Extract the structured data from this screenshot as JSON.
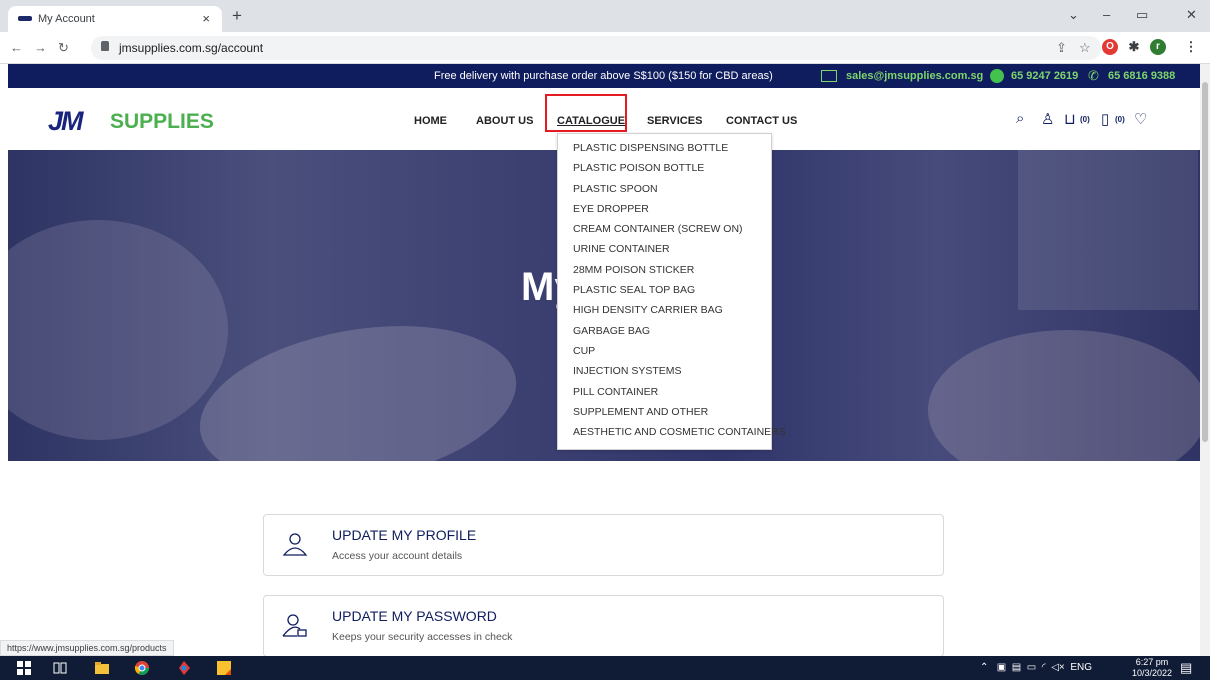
{
  "browser": {
    "tab_title": "My Account",
    "tab_close": "×",
    "new_tab": "+",
    "url": "jmsupplies.com.sg/account",
    "status_url": "https://www.jmsupplies.com.sg/products"
  },
  "topbar": {
    "promo": "Free delivery with purchase order above S$100 ($150 for CBD areas)",
    "email": "sales@jmsupplies.com.sg",
    "whatsapp": "65 9247 2619",
    "phone": "65 6816 9388"
  },
  "logo": {
    "jm": "JM",
    "supplies": "SUPPLIES"
  },
  "nav": {
    "home": "HOME",
    "about": "ABOUT US",
    "catalogue": "CATALOGUE",
    "services": "SERVICES",
    "contact": "CONTACT US"
  },
  "header_counts": {
    "cart": "(0)",
    "quote": "(0)"
  },
  "catalogue_menu": [
    "PLASTIC DISPENSING BOTTLE",
    "PLASTIC POISON BOTTLE",
    "PLASTIC SPOON",
    "EYE DROPPER",
    "CREAM CONTAINER (SCREW ON)",
    "URINE CONTAINER",
    "28MM POISON STICKER",
    "PLASTIC SEAL TOP BAG",
    "HIGH DENSITY CARRIER BAG",
    "GARBAGE BAG",
    "CUP",
    "INJECTION SYSTEMS",
    "PILL CONTAINER",
    "SUPPLEMENT AND OTHER",
    "AESTHETIC AND COSMETIC CONTAINERS"
  ],
  "hero": {
    "title_visible": "My"
  },
  "cards": [
    {
      "title": "UPDATE MY PROFILE",
      "subtitle": "Access your account details"
    },
    {
      "title": "UPDATE MY PASSWORD",
      "subtitle": "Keeps your security accesses in check"
    }
  ],
  "taskbar": {
    "lang": "ENG",
    "time": "6:27 pm",
    "date": "10/3/2022"
  },
  "colors": {
    "brand_navy": "#0f1d5e",
    "brand_green": "#4caf50",
    "highlight_red": "#e51b24"
  }
}
